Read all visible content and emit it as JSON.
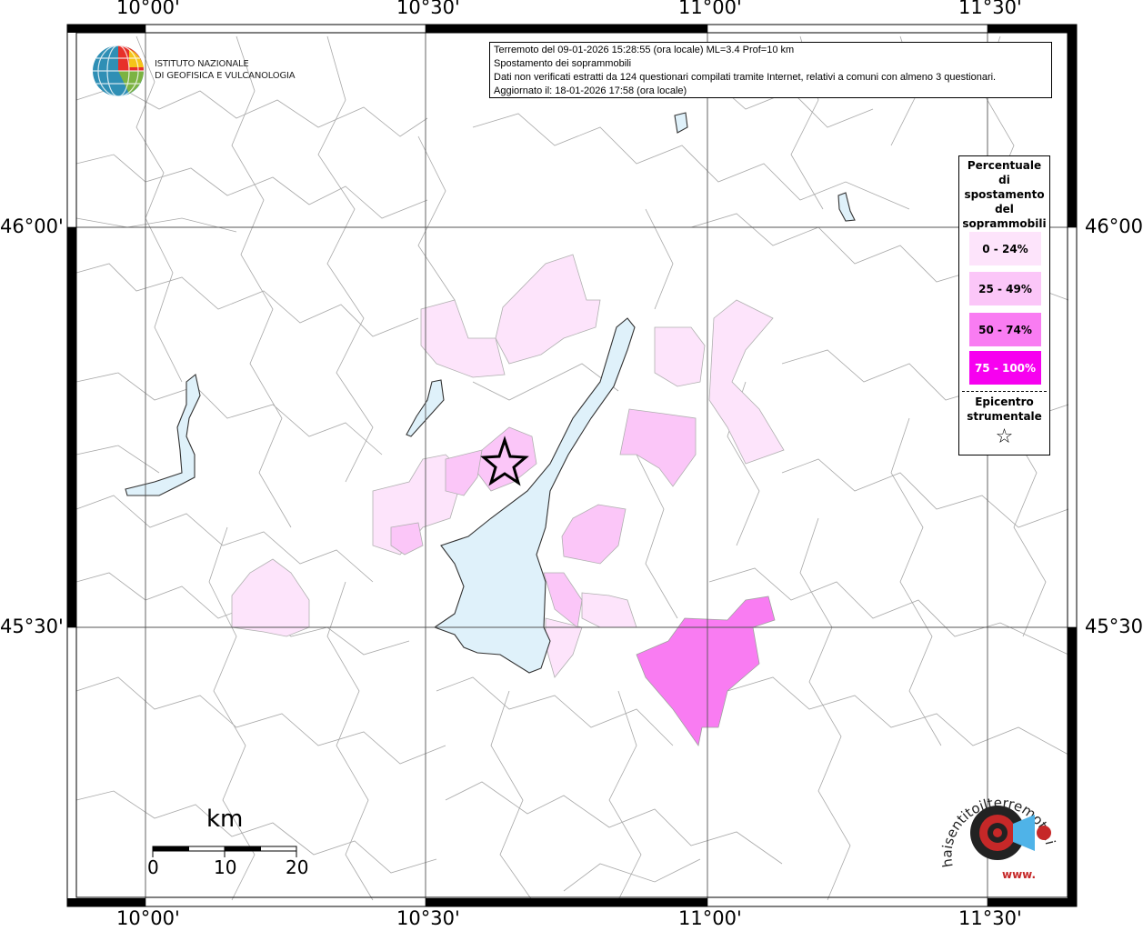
{
  "map": {
    "lon_labels": [
      "10°00'",
      "10°30'",
      "11°00'",
      "11°30'"
    ],
    "lat_labels": [
      "46°00'",
      "45°30'"
    ],
    "colors": {
      "lake": "#dff1fa",
      "class_0_24": "#fde4fb",
      "class_25_49": "#fbc6f8",
      "class_50_74": "#f97cf2",
      "class_75_100": "#f700f0",
      "borders": "#9a9a9a"
    }
  },
  "info": {
    "line1": "Terremoto del 09-01-2026 15:28:55 (ora locale) ML=3.4 Prof=10 km",
    "line2": "Spostamento dei soprammobili",
    "line3": "Dati non verificati estratti da 124 questionari compilati tramite Internet, relativi a comuni con almeno 3 questionari.",
    "line4": "Aggiornato il: 18-01-2026 17:58 (ora locale)"
  },
  "logo": {
    "line1": "ISTITUTO NAZIONALE",
    "line2": "DI GEOFISICA E VULCANOLOGIA",
    "icon": "ingv-globe-icon"
  },
  "legend": {
    "title_lines": [
      "Percentuale",
      "di",
      "spostamento",
      "del",
      "soprammobili"
    ],
    "classes": [
      {
        "label": "0 - 24%"
      },
      {
        "label": "25 - 49%"
      },
      {
        "label": "50 - 74%"
      },
      {
        "label": "75 - 100%"
      }
    ],
    "epicenter_lines": [
      "Epicentro",
      "strumentale"
    ],
    "epicenter_icon": "star-icon"
  },
  "scale": {
    "unit": "km",
    "ticks": [
      "0",
      "10",
      "20"
    ]
  },
  "hst_logo": {
    "text": "haisentitoilterremoto.it",
    "prefix": "www.",
    "icon": "target-megaphone-icon"
  }
}
